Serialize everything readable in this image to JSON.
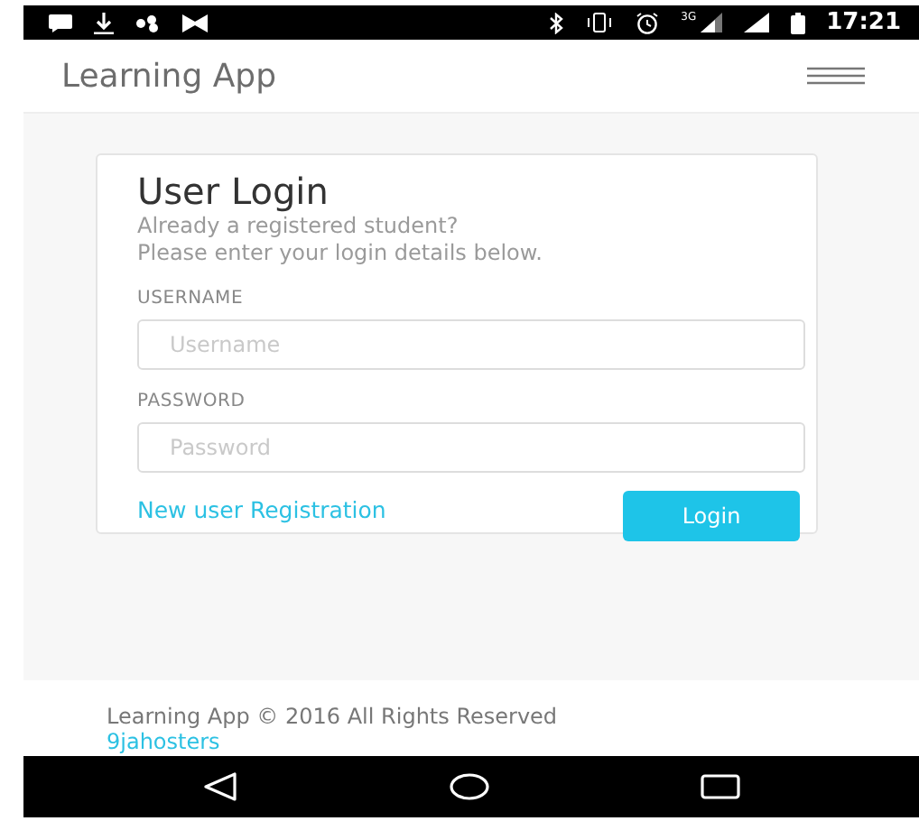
{
  "status_bar": {
    "network": "3G",
    "time": "17:21"
  },
  "header": {
    "title": "Learning App"
  },
  "login": {
    "title": "User Login",
    "subtitle": "Already a registered student?",
    "instructions": "Please enter your login details below.",
    "fields": [
      {
        "label": "USERNAME",
        "placeholder": "Username"
      },
      {
        "label": "PASSWORD",
        "placeholder": "Password"
      }
    ],
    "register_link": "New user Registration",
    "submit": "Login"
  },
  "footer": {
    "copyright": "Learning App © 2016 All Rights Reserved",
    "link": "9jahosters"
  }
}
